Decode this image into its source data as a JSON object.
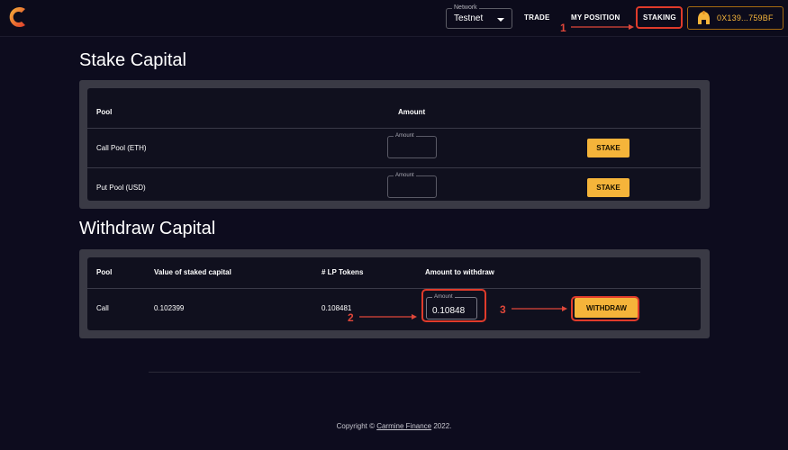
{
  "header": {
    "network_label": "Network",
    "network_value": "Testnet",
    "nav": {
      "trade": "TRADE",
      "my_position": "MY POSITION",
      "staking": "STAKING"
    },
    "wallet_address": "0X139...759BF"
  },
  "stake": {
    "title": "Stake Capital",
    "columns": {
      "pool": "Pool",
      "amount": "Amount"
    },
    "rows": [
      {
        "pool": "Call Pool (ETH)",
        "amount_label": "Amount",
        "amount_value": "",
        "button": "STAKE"
      },
      {
        "pool": "Put Pool (USD)",
        "amount_label": "Amount",
        "amount_value": "",
        "button": "STAKE"
      }
    ]
  },
  "withdraw": {
    "title": "Withdraw Capital",
    "columns": {
      "pool": "Pool",
      "value": "Value of staked capital",
      "lp_tokens": "# LP Tokens",
      "amount": "Amount to withdraw"
    },
    "rows": [
      {
        "pool": "Call",
        "value": "0.102399",
        "lp_tokens": "0.108481",
        "amount_label": "Amount",
        "amount_value": "0.10848",
        "button": "WITHDRAW"
      }
    ]
  },
  "annotations": {
    "a1": "1",
    "a2": "2",
    "a3": "3"
  },
  "footer": {
    "prefix": "Copyright © ",
    "link": "Carmine Finance",
    "suffix": " 2022."
  },
  "colors": {
    "accent": "#f5b43a",
    "highlight": "#e03b2b",
    "background": "#0d0c1e"
  }
}
